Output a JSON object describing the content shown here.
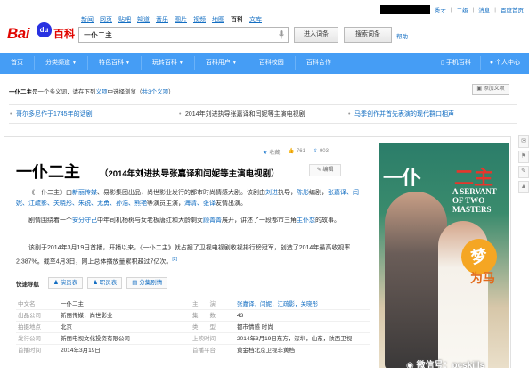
{
  "top_links": [
    "新闻",
    "网页",
    "贴吧",
    "知道",
    "音乐",
    "图片",
    "视频",
    "地图",
    "百科",
    "文库"
  ],
  "user_bar": {
    "links": [
      "秀才",
      "二级",
      "消息",
      "百度首页"
    ]
  },
  "logo": {
    "part1": "Bai",
    "paw": "du",
    "part2": "百科"
  },
  "search": {
    "value": "一仆二主",
    "enter_button": "进入词条",
    "search_button": "搜索词条",
    "help": "帮助"
  },
  "nav": {
    "items": [
      "首页",
      "分类频道",
      "特色百科",
      "玩转百科",
      "百科用户",
      "百科校园",
      "百科合作"
    ],
    "dropdowns": [
      false,
      true,
      true,
      true,
      true,
      false,
      false
    ],
    "right": [
      "手机百科",
      "个人中心"
    ]
  },
  "disambiguation": {
    "term": "一仆二主",
    "text1": "是一个多义词，请在下列",
    "link1": "义项",
    "text2": "中选择浏览（",
    "link2": "共3个义项",
    "text3": "）",
    "add_button": "添加义项"
  },
  "news": [
    "哥尔多尼作于1745年的话剧",
    "2014年刘进执导张嘉译和闫妮等主演电视剧",
    "马季创作并首先表演的现代群口相声"
  ],
  "article": {
    "title": "一仆二主",
    "subtitle": "（2014年刘进执导张嘉译和闫妮等主演电视剧）",
    "edit_button": "编辑",
    "actions": {
      "collect": "收藏",
      "likes": "761",
      "shares": "903"
    },
    "p1": [
      {
        "t": "《一仆二主》由",
        "l": false
      },
      {
        "t": "新丽传媒",
        "l": true
      },
      {
        "t": "、易影集团出品，尚世影业发行的都市时尚情感大剧。该剧由",
        "l": false
      },
      {
        "t": "刘进",
        "l": true
      },
      {
        "t": "执导，",
        "l": false
      },
      {
        "t": "陈彤",
        "l": true
      },
      {
        "t": "编剧，",
        "l": false
      },
      {
        "t": "张嘉译、闫妮、江疏影、关晓彤、朱锐、尤勇、孙浩、熊艳",
        "l": true
      },
      {
        "t": "等演员主演，",
        "l": false
      },
      {
        "t": "海清、张译",
        "l": true
      },
      {
        "t": "友情出演。",
        "l": false
      }
    ],
    "p2": [
      {
        "t": "剧情围绕着一个",
        "l": false
      },
      {
        "t": "安分守己",
        "l": true
      },
      {
        "t": "中年司机杨树与女老板唐红和大龄剩女",
        "l": false
      },
      {
        "t": "顾菁菁",
        "l": true
      },
      {
        "t": "展开，讲述了一段都市三角",
        "l": false
      },
      {
        "t": "主仆恋",
        "l": true
      },
      {
        "t": "的故事。",
        "l": false
      }
    ],
    "p3": "该剧于2014年3月19日首播，开播以来，《一仆二主》就占据了卫视电视剧收视排行榜冠军，创造了2014年最高收视率2.387%。截至4月3日，网上总体播放量累积超过7亿次。",
    "p3_ref": "[2]"
  },
  "quicknav": {
    "label": "快速导航",
    "buttons": [
      "演员表",
      "职员表",
      "分集剧情"
    ]
  },
  "infobox": [
    [
      "中文名",
      "一仆二主",
      "主　　演",
      "张嘉译，闫妮，江疏影，关晓彤"
    ],
    [
      "出品公司",
      "新丽传媒，尚世影业",
      "集　　数",
      "43"
    ],
    [
      "拍摄地点",
      "北京",
      "类　　型",
      "都市情感 时尚"
    ],
    [
      "发行公司",
      "新丽电视文化投资有限公司",
      "上映时间",
      "2014年3月19日东方，深圳，山东，陕西卫视"
    ],
    [
      "首播时间",
      "2014年3月19日",
      "首播平台",
      "黄金档北京卫视非黄档"
    ]
  ],
  "poster": {
    "title1": "一仆",
    "title2": "二主",
    "english_line1": "A SERVANT",
    "english_line2": "OF TWO MASTERS",
    "stamp": "梦",
    "stamp2": "为马",
    "watermark": "微信号：pcskills"
  },
  "colors": {
    "nav_bg": "#459df5",
    "link": "#136ec2",
    "logo_red": "#e10601",
    "logo_blue": "#2932e1"
  }
}
